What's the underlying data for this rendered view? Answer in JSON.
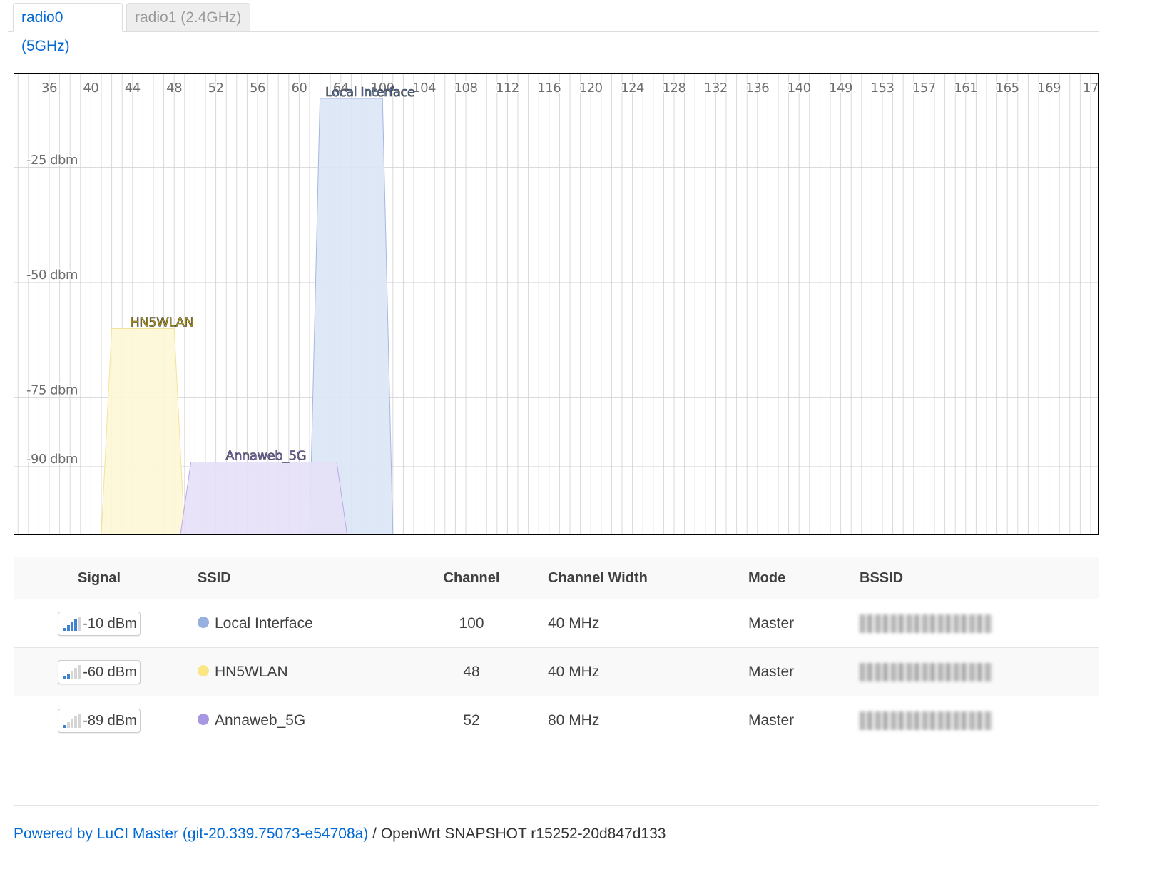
{
  "tabs": [
    {
      "label": "radio0 (5GHz)",
      "active": true
    },
    {
      "label": "radio1 (2.4GHz)",
      "active": false
    }
  ],
  "chart_data": {
    "type": "area",
    "x_channels": [
      "36",
      "40",
      "44",
      "48",
      "52",
      "56",
      "60",
      "64",
      "100",
      "104",
      "108",
      "112",
      "116",
      "120",
      "124",
      "128",
      "132",
      "136",
      "140",
      "149",
      "153",
      "157",
      "161",
      "165",
      "169",
      "17"
    ],
    "y_ticks": [
      {
        "label": "-25 dbm",
        "value": -25
      },
      {
        "label": "-50 dbm",
        "value": -50
      },
      {
        "label": "-75 dbm",
        "value": -75
      },
      {
        "label": "-90 dbm",
        "value": -90
      }
    ],
    "ylim": [
      -100,
      0
    ],
    "series": [
      {
        "name": "Local Interface",
        "channel": 100,
        "width_mhz": 40,
        "signal_dbm": -10,
        "fill": "#dce5f5",
        "stroke": "#a3b8e0",
        "label_color": "#5b79b5"
      },
      {
        "name": "HN5WLAN",
        "channel": 48,
        "width_mhz": 40,
        "signal_dbm": -60,
        "fill": "#fdf7d6",
        "stroke": "#f3e39a",
        "label_color": "#c6a90e"
      },
      {
        "name": "Annaweb_5G",
        "channel": 52,
        "width_mhz": 80,
        "signal_dbm": -89,
        "fill": "#e6e0f7",
        "stroke": "#b8abe6",
        "label_color": "#7e6cc4"
      }
    ]
  },
  "table": {
    "headers": {
      "signal": "Signal",
      "ssid": "SSID",
      "channel": "Channel",
      "width": "Channel Width",
      "mode": "Mode",
      "bssid": "BSSID"
    },
    "rows": [
      {
        "signal": "-10 dBm",
        "bars": 4,
        "ssid": "Local Interface",
        "dot_color": "#98b0dd",
        "channel": "100",
        "width": "40 MHz",
        "mode": "Master"
      },
      {
        "signal": "-60 dBm",
        "bars": 2,
        "ssid": "HN5WLAN",
        "dot_color": "#fbe687",
        "channel": "48",
        "width": "40 MHz",
        "mode": "Master"
      },
      {
        "signal": "-89 dBm",
        "bars": 1,
        "ssid": "Annaweb_5G",
        "dot_color": "#a797e3",
        "channel": "52",
        "width": "80 MHz",
        "mode": "Master"
      }
    ]
  },
  "footer": {
    "link_text": "Powered by LuCI Master (git-20.339.75073-e54708a)",
    "rest_text": " / OpenWrt SNAPSHOT r15252-20d847d133"
  }
}
